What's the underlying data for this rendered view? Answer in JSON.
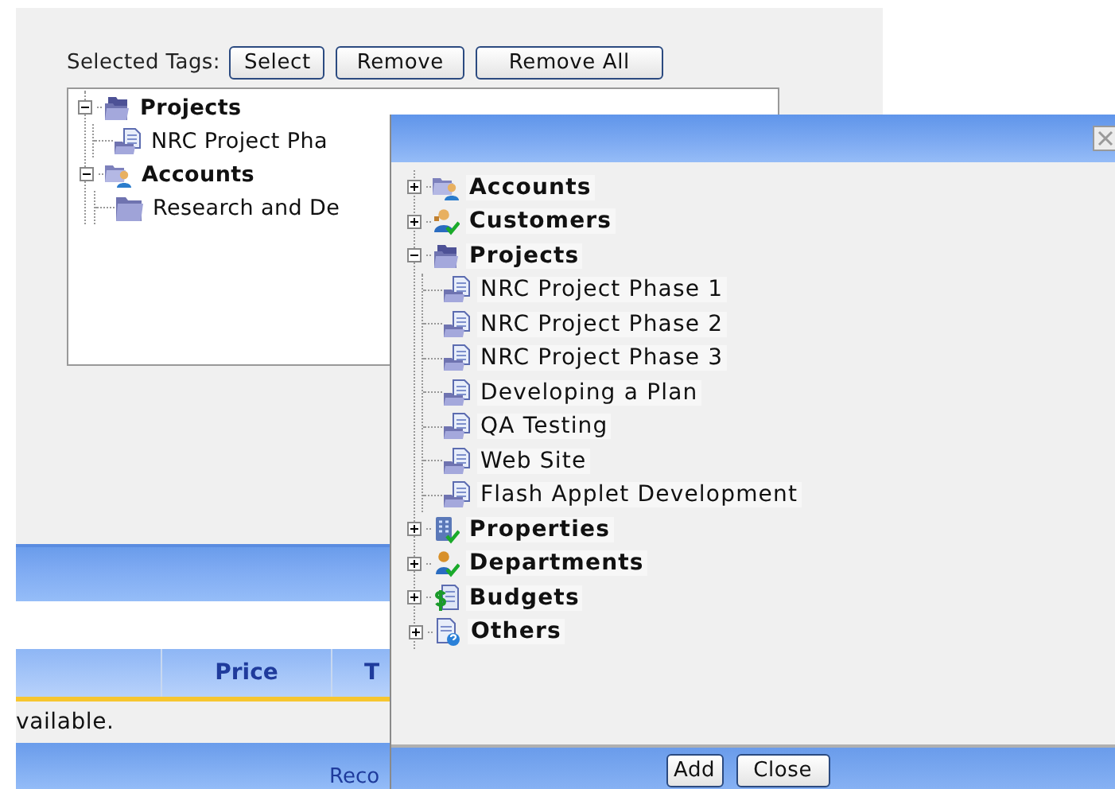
{
  "selected_tags": {
    "label": "Selected Tags:",
    "buttons": [
      "Select",
      "Remove",
      "Remove All"
    ],
    "tree": [
      {
        "label": "Projects",
        "kind": "projects",
        "expanded": true,
        "children": [
          {
            "label": "NRC Project Pha",
            "kind": "doc"
          }
        ]
      },
      {
        "label": "Accounts",
        "kind": "account",
        "expanded": true,
        "children": [
          {
            "label": "Research and De",
            "kind": "folder"
          }
        ]
      }
    ]
  },
  "table": {
    "columns": [
      "Price",
      "T"
    ],
    "message": "vailable.",
    "footer": "Reco"
  },
  "dialog": {
    "tree": [
      {
        "label": "Accounts",
        "kind": "account",
        "expanded": false
      },
      {
        "label": "Customers",
        "kind": "customer",
        "expanded": false
      },
      {
        "label": "Projects",
        "kind": "projects",
        "expanded": true,
        "children": [
          {
            "label": "NRC Project Phase 1",
            "kind": "doc"
          },
          {
            "label": "NRC Project Phase 2",
            "kind": "doc"
          },
          {
            "label": "NRC Project Phase 3",
            "kind": "doc"
          },
          {
            "label": "Developing a Plan",
            "kind": "doc"
          },
          {
            "label": "QA Testing",
            "kind": "doc"
          },
          {
            "label": "Web Site",
            "kind": "doc"
          },
          {
            "label": "Flash Applet Development",
            "kind": "doc"
          }
        ]
      },
      {
        "label": "Properties",
        "kind": "property",
        "expanded": false
      },
      {
        "label": "Departments",
        "kind": "department",
        "expanded": false
      },
      {
        "label": "Budgets",
        "kind": "budget",
        "expanded": false
      },
      {
        "label": "Others",
        "kind": "other",
        "expanded": false
      }
    ],
    "buttons": [
      "Add",
      "Close"
    ]
  }
}
